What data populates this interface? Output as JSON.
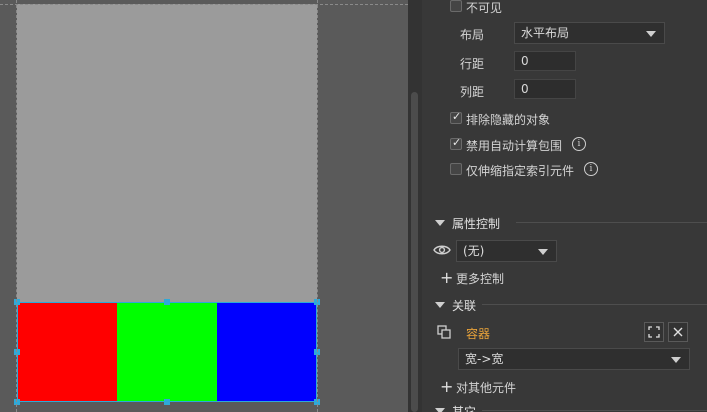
{
  "canvas": {
    "cells": [
      {
        "name": "red-cell",
        "color": "#ff0000"
      },
      {
        "name": "green-cell",
        "color": "#00ff00"
      },
      {
        "name": "blue-cell",
        "color": "#0000ff"
      }
    ],
    "board_color": "#9b9b9b",
    "selection_color": "#2fa9d8"
  },
  "panel": {
    "invisible_label": "不可见",
    "layout_label": "布局",
    "layout_value": "水平布局",
    "row_spacing_label": "行距",
    "row_spacing_value": "0",
    "col_spacing_label": "列距",
    "col_spacing_value": "0",
    "exclude_hidden_label": "排除隐藏的对象",
    "exclude_hidden_checked": true,
    "disable_auto_bounds_label": "禁用自动计算包围",
    "disable_auto_bounds_checked": true,
    "scale_indexed_only_label": "仅伸缩指定索引元件",
    "scale_indexed_only_checked": false,
    "info_glyph": "i",
    "property_control": {
      "title": "属性控制",
      "select_value": "(无)",
      "more_label": "更多控制"
    },
    "association": {
      "title": "关联",
      "target_label": "容器",
      "target_color": "#e8a33a",
      "mapping_value": "宽->宽",
      "add_label": "对其他元件"
    },
    "other": {
      "title": "其它"
    }
  }
}
